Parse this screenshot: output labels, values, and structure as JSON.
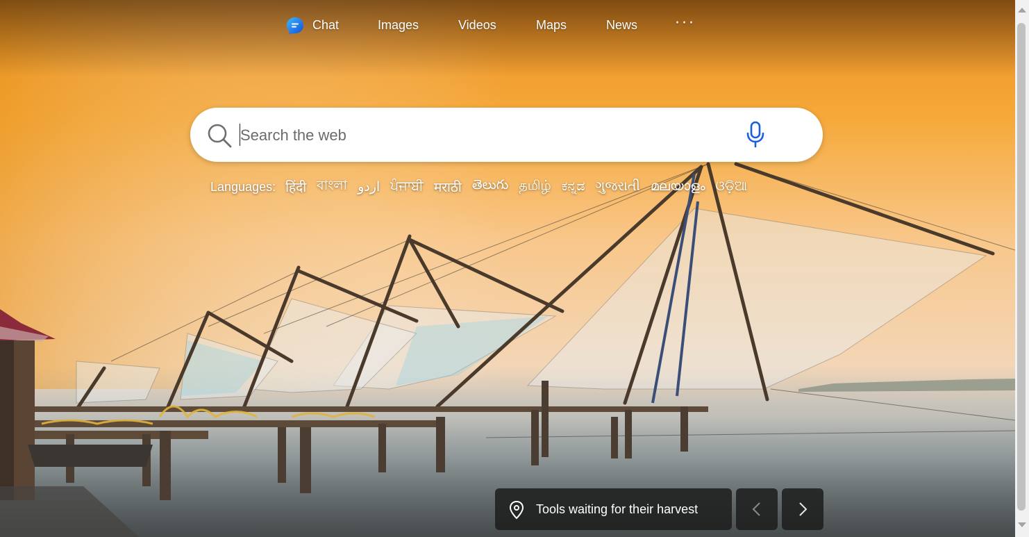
{
  "nav": {
    "items": [
      {
        "label": "Chat",
        "icon": "chat-icon"
      },
      {
        "label": "Images"
      },
      {
        "label": "Videos"
      },
      {
        "label": "Maps"
      },
      {
        "label": "News"
      }
    ],
    "more_label": "···"
  },
  "search": {
    "placeholder": "Search the web",
    "value": "",
    "search_icon": "search-icon",
    "mic_icon": "microphone-icon"
  },
  "languages": {
    "label": "Languages:",
    "items": [
      "हिंदी",
      "বাংলা",
      "اردو",
      "ਪੰਜਾਬੀ",
      "मराठी",
      "తెలుగు",
      "தமிழ்",
      "ಕನ್ನಡ",
      "ગુજરાતી",
      "മലയാളം",
      "ଓଡ଼ିଆ"
    ]
  },
  "background": {
    "caption": "Tools waiting for their harvest",
    "caption_icon": "location-pin-icon",
    "prev_icon": "chevron-left-icon",
    "next_icon": "chevron-right-icon"
  },
  "colors": {
    "accent_blue": "#1a5fd6",
    "sky_top": "#f4a632",
    "sky_mid": "#f8c98a",
    "water": "#9aa8ac"
  }
}
